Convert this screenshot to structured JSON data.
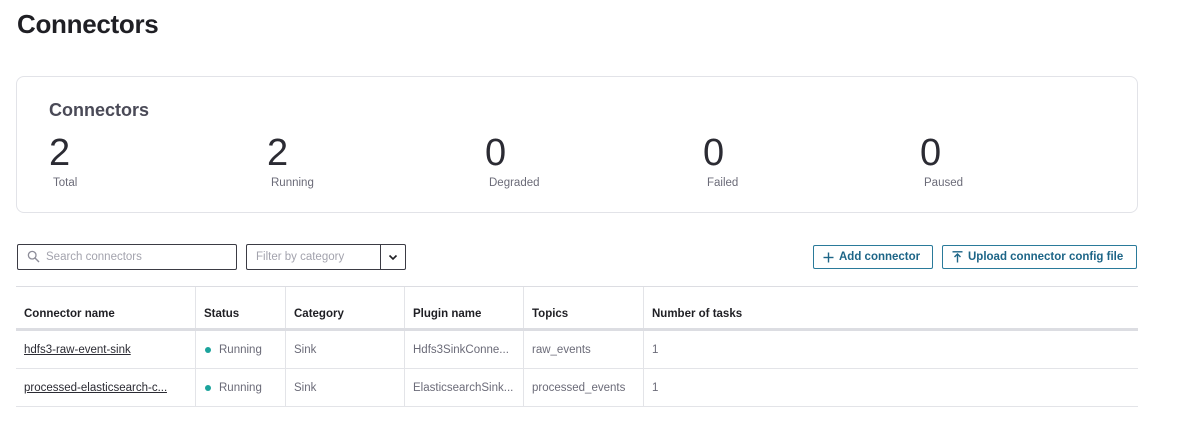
{
  "page": {
    "title": "Connectors"
  },
  "summary": {
    "title": "Connectors",
    "stats": [
      {
        "value": "2",
        "label": "Total"
      },
      {
        "value": "2",
        "label": "Running"
      },
      {
        "value": "0",
        "label": "Degraded"
      },
      {
        "value": "0",
        "label": "Failed"
      },
      {
        "value": "0",
        "label": "Paused"
      }
    ]
  },
  "toolbar": {
    "search_placeholder": "Search connectors",
    "filter_placeholder": "Filter by category",
    "add_label": "Add connector",
    "upload_label": "Upload connector config file"
  },
  "table": {
    "columns": [
      "Connector name",
      "Status",
      "Category",
      "Plugin name",
      "Topics",
      "Number of tasks"
    ],
    "rows": [
      {
        "name": "hdfs3-raw-event-sink",
        "status": "Running",
        "category": "Sink",
        "plugin": "Hdfs3SinkConne...",
        "topics": "raw_events",
        "tasks": "1"
      },
      {
        "name": "processed-elasticsearch-c...",
        "status": "Running",
        "category": "Sink",
        "plugin": "ElasticsearchSink...",
        "topics": "processed_events",
        "tasks": "1"
      }
    ]
  },
  "colors": {
    "accent": "#1d6587",
    "running": "#1ba39c"
  }
}
